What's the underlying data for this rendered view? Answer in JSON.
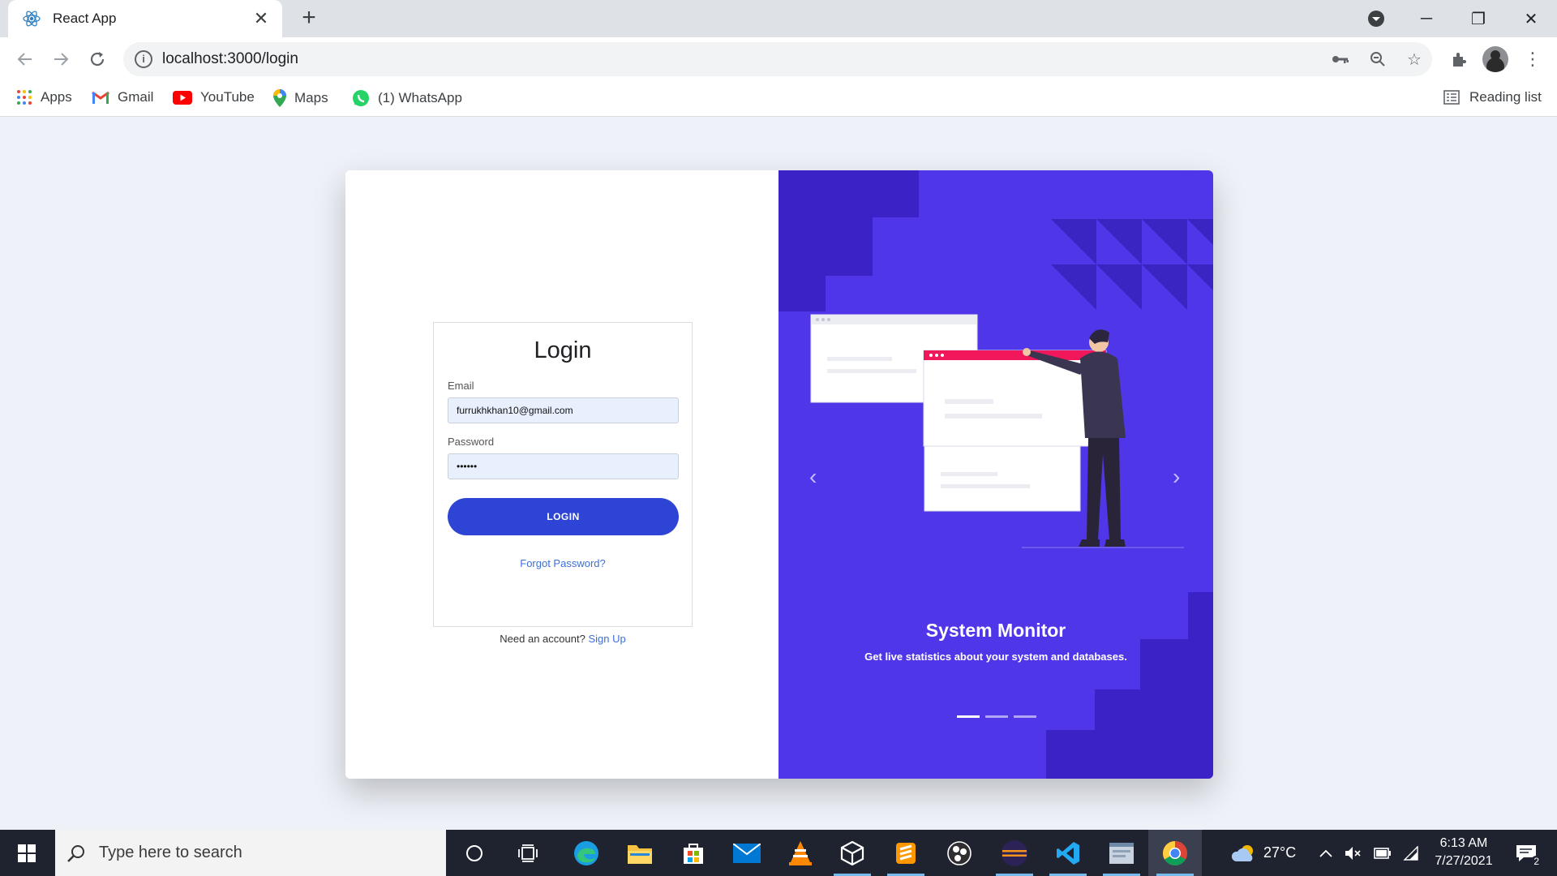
{
  "browser": {
    "tab_title": "React App",
    "url": "localhost:3000/login",
    "bookmarks": [
      {
        "label": "Apps",
        "icon": "apps-grid-icon"
      },
      {
        "label": "Gmail",
        "icon": "gmail-icon"
      },
      {
        "label": "YouTube",
        "icon": "youtube-icon"
      },
      {
        "label": "Maps",
        "icon": "maps-icon"
      },
      {
        "label": "(1) WhatsApp",
        "icon": "whatsapp-icon"
      }
    ],
    "reading_list": "Reading list"
  },
  "login": {
    "title": "Login",
    "email_label": "Email",
    "email_value": "furrukhkhan10@gmail.com",
    "password_label": "Password",
    "password_value": "••••••",
    "button_label": "LOGIN",
    "forgot_link": "Forgot Password?",
    "signup_prompt": "Need an account?",
    "signup_link": "Sign Up"
  },
  "carousel": {
    "title": "System Monitor",
    "subtitle": "Get live statistics about your system and databases.",
    "active_slide": 1,
    "slide_count": 3
  },
  "taskbar": {
    "search_placeholder": "Type here to search",
    "weather": "27°C",
    "time": "6:13 AM",
    "date": "7/27/2021",
    "notifications": "2"
  },
  "colors": {
    "accent": "#4f36e8",
    "button": "#2d44d4",
    "link": "#3d6fd6"
  }
}
